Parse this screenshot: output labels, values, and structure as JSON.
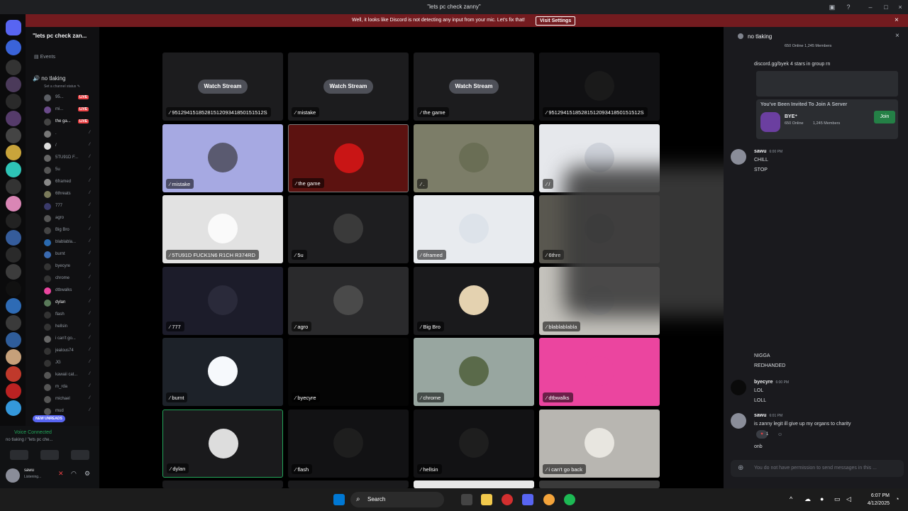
{
  "window": {
    "title": "\"lets pc check zanny\""
  },
  "banner": {
    "message": "Well, it looks like Discord is not detecting any input from your mic. Let's fix that!",
    "action": "Visit Settings",
    "close": "×"
  },
  "server": {
    "name": "\"lets pc check zan...",
    "events_label": "Events"
  },
  "voice_channel": {
    "name": "no tlaking",
    "status_placeholder": "Set a channel status ✎"
  },
  "members": [
    {
      "name": "95...",
      "live": "LIVE"
    },
    {
      "name": "mi...",
      "live": "LIVE"
    },
    {
      "name": "the ga...",
      "live": "LIVE"
    },
    {
      "name": ".",
      "live": ""
    },
    {
      "name": "/",
      "live": ""
    },
    {
      "name": "5TU91D F...",
      "live": ""
    },
    {
      "name": "5u",
      "live": ""
    },
    {
      "name": "6framed",
      "live": ""
    },
    {
      "name": "6threats",
      "live": ""
    },
    {
      "name": "777",
      "live": ""
    },
    {
      "name": "agro",
      "live": ""
    },
    {
      "name": "Big Bro",
      "live": ""
    },
    {
      "name": "blablabla...",
      "live": ""
    },
    {
      "name": "burnt",
      "live": ""
    },
    {
      "name": "byecyre",
      "live": ""
    },
    {
      "name": "chrome",
      "live": ""
    },
    {
      "name": "dtbwalks",
      "live": ""
    },
    {
      "name": "dylan",
      "live": ""
    },
    {
      "name": "flash",
      "live": ""
    },
    {
      "name": "hellsin",
      "live": ""
    },
    {
      "name": "i can't go...",
      "live": ""
    },
    {
      "name": "jealous74",
      "live": ""
    },
    {
      "name": "JG",
      "live": ""
    },
    {
      "name": "kawaii cat...",
      "live": ""
    },
    {
      "name": "m_rda",
      "live": ""
    },
    {
      "name": "michael",
      "live": ""
    },
    {
      "name": "mud",
      "live": ""
    }
  ],
  "new_unreads": "NEW UNREADS",
  "voice_status": {
    "connected": "Voice Connected",
    "channel": "no tlaking / \"lets pc che...",
    "user": "sawu",
    "user_status": "Listening..."
  },
  "tiles": [
    {
      "label": "9512941518528151209341850151512S",
      "action": "Watch Stream",
      "bg": "#1c1c1e"
    },
    {
      "label": "mistake",
      "action": "Watch Stream",
      "bg": "#1c1c1e"
    },
    {
      "label": "the game",
      "action": "Watch Stream",
      "bg": "#1c1c1e"
    },
    {
      "label": "9512941518528151209341850151512S",
      "action": "",
      "bg": "#111113"
    },
    {
      "label": "mistake",
      "action": "",
      "bg": "#a6a9e2"
    },
    {
      "label": "the game",
      "action": "",
      "bg": "#5c1210"
    },
    {
      "label": ".",
      "action": "",
      "bg": "#7c7d68"
    },
    {
      "label": "/",
      "action": "",
      "bg": "#e6e8ec"
    },
    {
      "label": "5TU91D FUCK1N6 R1CH R374RD",
      "action": "",
      "bg": "#e2e2e2"
    },
    {
      "label": "5u",
      "action": "",
      "bg": "#1e1e20"
    },
    {
      "label": "6framed",
      "action": "",
      "bg": "#e8ebef"
    },
    {
      "label": "6thre",
      "action": "",
      "bg": "#5a5850"
    },
    {
      "label": "777",
      "action": "",
      "bg": "#1c1c2a"
    },
    {
      "label": "agro",
      "action": "",
      "bg": "#2a2a2c"
    },
    {
      "label": "Big Bro",
      "action": "",
      "bg": "#1a1a1c"
    },
    {
      "label": "blablablabla",
      "action": "",
      "bg": "#c5c3bd"
    },
    {
      "label": "burnt",
      "action": "",
      "bg": "#1d2229"
    },
    {
      "label": "byecyre",
      "action": "",
      "bg": "#050505"
    },
    {
      "label": "chrome",
      "action": "",
      "bg": "#98a6a0"
    },
    {
      "label": "dtbwalks",
      "action": "",
      "bg": "#eb459f"
    },
    {
      "label": "dylan",
      "action": "",
      "bg": "#1a1a1c"
    },
    {
      "label": "flash",
      "action": "",
      "bg": "#121214"
    },
    {
      "label": "hellsin",
      "action": "",
      "bg": "#121214"
    },
    {
      "label": "i can't go back",
      "action": "",
      "bg": "#b8b6b1"
    }
  ],
  "chat": {
    "channel": "no tlaking",
    "top_meta": "650 Online  1,245 Members",
    "link": "discord.gg/byek 4 stars in group rn",
    "invite": {
      "heading": "You've Been Invited To Join A Server",
      "server": "BYE⁺",
      "online": "650 Online",
      "members": "1,245 Members",
      "join": "Join"
    },
    "messages": [
      {
        "author": "sawu",
        "time": "6:00 PM",
        "lines": [
          "CHILL",
          "STOP"
        ]
      },
      {
        "author": "",
        "time": "",
        "lines": [
          "NIGGA",
          "REDHANDED"
        ]
      },
      {
        "author": "byecyre",
        "time": "6:00 PM",
        "lines": [
          "LOL",
          "LOLL"
        ]
      },
      {
        "author": "sawu",
        "time": "6:01 PM",
        "lines": [
          "is zanny legit ill give up my organs to charity"
        ]
      },
      {
        "author": "",
        "time": "",
        "lines": [
          "onb"
        ]
      }
    ],
    "reaction_count": "1",
    "input_placeholder": "You do not have permission to send messages in this ..."
  },
  "taskbar": {
    "search": "Search",
    "time": "6:07 PM",
    "date": "4/12/2025"
  },
  "colors": {
    "accent": "#5865f2",
    "live": "#ed4245",
    "online": "#23a55a",
    "banner": "#731b1f"
  }
}
